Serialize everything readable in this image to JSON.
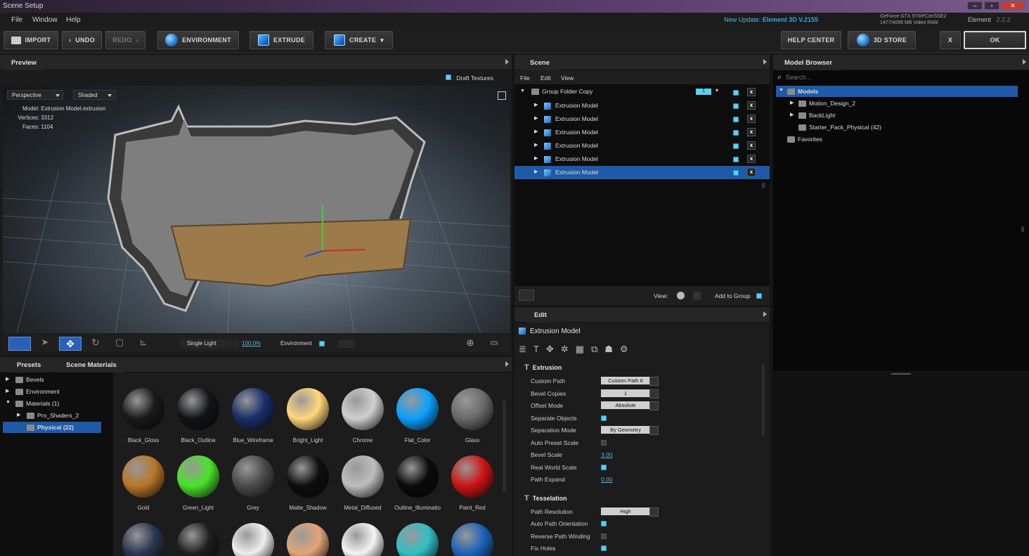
{
  "window": {
    "title": "Scene Setup"
  },
  "menu": [
    "File",
    "Window",
    "Help"
  ],
  "update": {
    "prefix": "New Update: ",
    "name": "Element 3D V.2155"
  },
  "gpu": {
    "line1": "GeForce GTX 970/PCIe/SSE2",
    "line2": "1477/4096 MB Video RAM"
  },
  "element": {
    "name": "Element",
    "version": "2.2.2"
  },
  "toolbar": {
    "import": "IMPORT",
    "undo": "UNDO",
    "redo": "REDO",
    "environment": "ENVIRONMENT",
    "extrude": "EXTRUDE",
    "create": "CREATE",
    "help": "HELP CENTER",
    "store": "3D STORE",
    "close": "X",
    "ok": "OK"
  },
  "preview": {
    "title": "Preview",
    "draft": "Draft Textures",
    "camera": "Perspective",
    "shading": "Shaded",
    "model_label": "Model:",
    "model": "Extrusion Model.extrusion",
    "vertices_label": "Vertices:",
    "vertices": "3312",
    "faces_label": "Faces:",
    "faces": "1104",
    "light": "Single Light",
    "zoom": "100.0%",
    "environment": "Environment"
  },
  "scene": {
    "title": "Scene",
    "menu": [
      "File",
      "Edit",
      "View"
    ],
    "group": "Group Folder Copy",
    "group_badge": "1",
    "items": [
      "Extrusion Model",
      "Extrusion Model",
      "Extrusion Model",
      "Extrusion Model",
      "Extrusion Model",
      "Extrusion Model"
    ],
    "selected_index": 5,
    "view_label": "View:",
    "add_to_group": "Add to Group"
  },
  "model_browser": {
    "title": "Model Browser",
    "search_placeholder": "Search...",
    "tree": [
      {
        "label": "Models",
        "level": 0,
        "selected": true
      },
      {
        "label": "Motion_Design_2",
        "level": 1
      },
      {
        "label": "BackLight",
        "level": 1
      },
      {
        "label": "Starter_Pack_Physical (42)",
        "level": 1
      },
      {
        "label": "Favorites",
        "level": 0
      }
    ]
  },
  "edit": {
    "title": "Edit",
    "object": "Extrusion Model",
    "sections": [
      {
        "name": "Extrusion",
        "props": [
          {
            "label": "Custom Path",
            "type": "dd",
            "value": "Custom Path 6"
          },
          {
            "label": "Bevel Copies",
            "type": "dd",
            "value": "1"
          },
          {
            "label": "Offset Mode",
            "type": "dd",
            "value": "Absolute"
          },
          {
            "label": "Separate Objects",
            "type": "chk",
            "value": "on"
          },
          {
            "label": "Separation Mode",
            "type": "dd",
            "value": "By Geometry"
          },
          {
            "label": "Auto Preset Scale",
            "type": "chk",
            "value": "off"
          },
          {
            "label": "Bevel Scale",
            "type": "link",
            "value": "3.00"
          },
          {
            "label": "Real World Scale",
            "type": "chk",
            "value": "on"
          },
          {
            "label": "Path Expand",
            "type": "link",
            "value": "0.00"
          }
        ]
      },
      {
        "name": "Tesselation",
        "props": [
          {
            "label": "Path Resolution",
            "type": "dd",
            "value": "High"
          },
          {
            "label": "Auto Path Orientation",
            "type": "chk",
            "value": "on"
          },
          {
            "label": "Reverse Path Winding",
            "type": "chk",
            "value": "off"
          },
          {
            "label": "Fix Holes",
            "type": "chk",
            "value": "on"
          }
        ]
      }
    ]
  },
  "presets": {
    "tab1": "Presets",
    "tab2": "Scene Materials",
    "tree": [
      {
        "label": "Bevels",
        "level": 0
      },
      {
        "label": "Environment",
        "level": 0
      },
      {
        "label": "Materials (1)",
        "level": 0
      },
      {
        "label": "Pro_Shaders_2",
        "level": 1
      },
      {
        "label": "Physical (22)",
        "level": 1,
        "selected": true
      }
    ],
    "materials": [
      {
        "name": "Black_Gloss",
        "color": "#1a1a1a"
      },
      {
        "name": "Black_Outline",
        "color": "#101418"
      },
      {
        "name": "Blue_Wireframe",
        "color": "#1a2f6a"
      },
      {
        "name": "Bright_Light",
        "color": "#ffd77a"
      },
      {
        "name": "Chrome",
        "color": "#cfcfcf"
      },
      {
        "name": "Flat_Color",
        "color": "#0aa0ff"
      },
      {
        "name": "Glass",
        "color": "#6a6a6a"
      },
      {
        "name": "Gold",
        "color": "#b8762a"
      },
      {
        "name": "Green_Light",
        "color": "#4ae22a"
      },
      {
        "name": "Grey",
        "color": "#4a4a4a"
      },
      {
        "name": "Matte_Shadow",
        "color": "#0e0e0e"
      },
      {
        "name": "Metal_Diffused",
        "color": "#bdbdbd"
      },
      {
        "name": "Outline_Illuminatio",
        "color": "#0a0a0a"
      },
      {
        "name": "Paint_Red",
        "color": "#cc1414"
      },
      {
        "name": "",
        "color": "#2a3550"
      },
      {
        "name": "",
        "color": "#1e1e1e"
      },
      {
        "name": "",
        "color": "#eeeeee"
      },
      {
        "name": "",
        "color": "#e2a577"
      },
      {
        "name": "",
        "color": "#f4f4f4"
      },
      {
        "name": "",
        "color": "#2fbfc4"
      },
      {
        "name": "",
        "color": "#1a62b8"
      }
    ]
  }
}
